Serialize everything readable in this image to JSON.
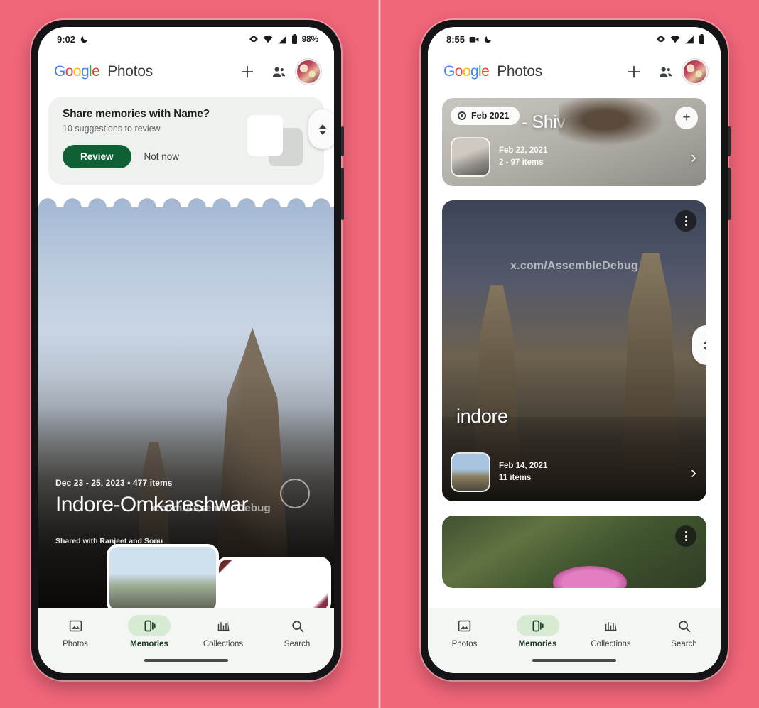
{
  "background_color": "#f2667a",
  "accent_green": "#0f6135",
  "phones": [
    {
      "id": "left",
      "status_bar": {
        "time": "9:02",
        "battery": "98%"
      },
      "app_bar": {
        "logo_google": "Google",
        "logo_photos": "Photos",
        "add_label": "+",
        "share_icon": "people-icon",
        "avatar": "account-avatar"
      },
      "share_card": {
        "title": "Share memories with Name?",
        "subtitle": "10 suggestions to review",
        "primary_button": "Review",
        "secondary_button": "Not now"
      },
      "hero_memory": {
        "date_line": "Dec 23 - 25, 2023  •  477 items",
        "title": "Indore-Omkareshwar",
        "shared_with": "Shared with Ranjeet and Sonu",
        "watermark": "x.com/AssembleDebug"
      },
      "nav": [
        {
          "label": "Photos",
          "icon": "photo-icon",
          "active": false
        },
        {
          "label": "Memories",
          "icon": "memories-icon",
          "active": true
        },
        {
          "label": "Collections",
          "icon": "collections-icon",
          "active": false
        },
        {
          "label": "Search",
          "icon": "search-icon",
          "active": false
        }
      ]
    },
    {
      "id": "right",
      "status_bar": {
        "time": "8:55",
        "battery": ""
      },
      "app_bar": {
        "logo_google": "Google",
        "logo_photos": "Photos",
        "add_label": "+",
        "share_icon": "people-icon",
        "avatar": "account-avatar"
      },
      "cards": [
        {
          "chip": "Feb 2021",
          "title": "- Shiv",
          "sub_date": "Feb 22, 2021",
          "sub_count": "2 - 97 items",
          "add_label": "+",
          "chevron": "›"
        },
        {
          "title": "indore",
          "sub_date": "Feb 14, 2021",
          "sub_count": "11 items",
          "watermark": "x.com/AssembleDebug",
          "chevron": "›"
        },
        {
          "title": "",
          "sub_date": "",
          "sub_count": ""
        }
      ],
      "nav": [
        {
          "label": "Photos",
          "icon": "photo-icon",
          "active": false
        },
        {
          "label": "Memories",
          "icon": "memories-icon",
          "active": true
        },
        {
          "label": "Collections",
          "icon": "collections-icon",
          "active": false
        },
        {
          "label": "Search",
          "icon": "search-icon",
          "active": false
        }
      ]
    }
  ]
}
